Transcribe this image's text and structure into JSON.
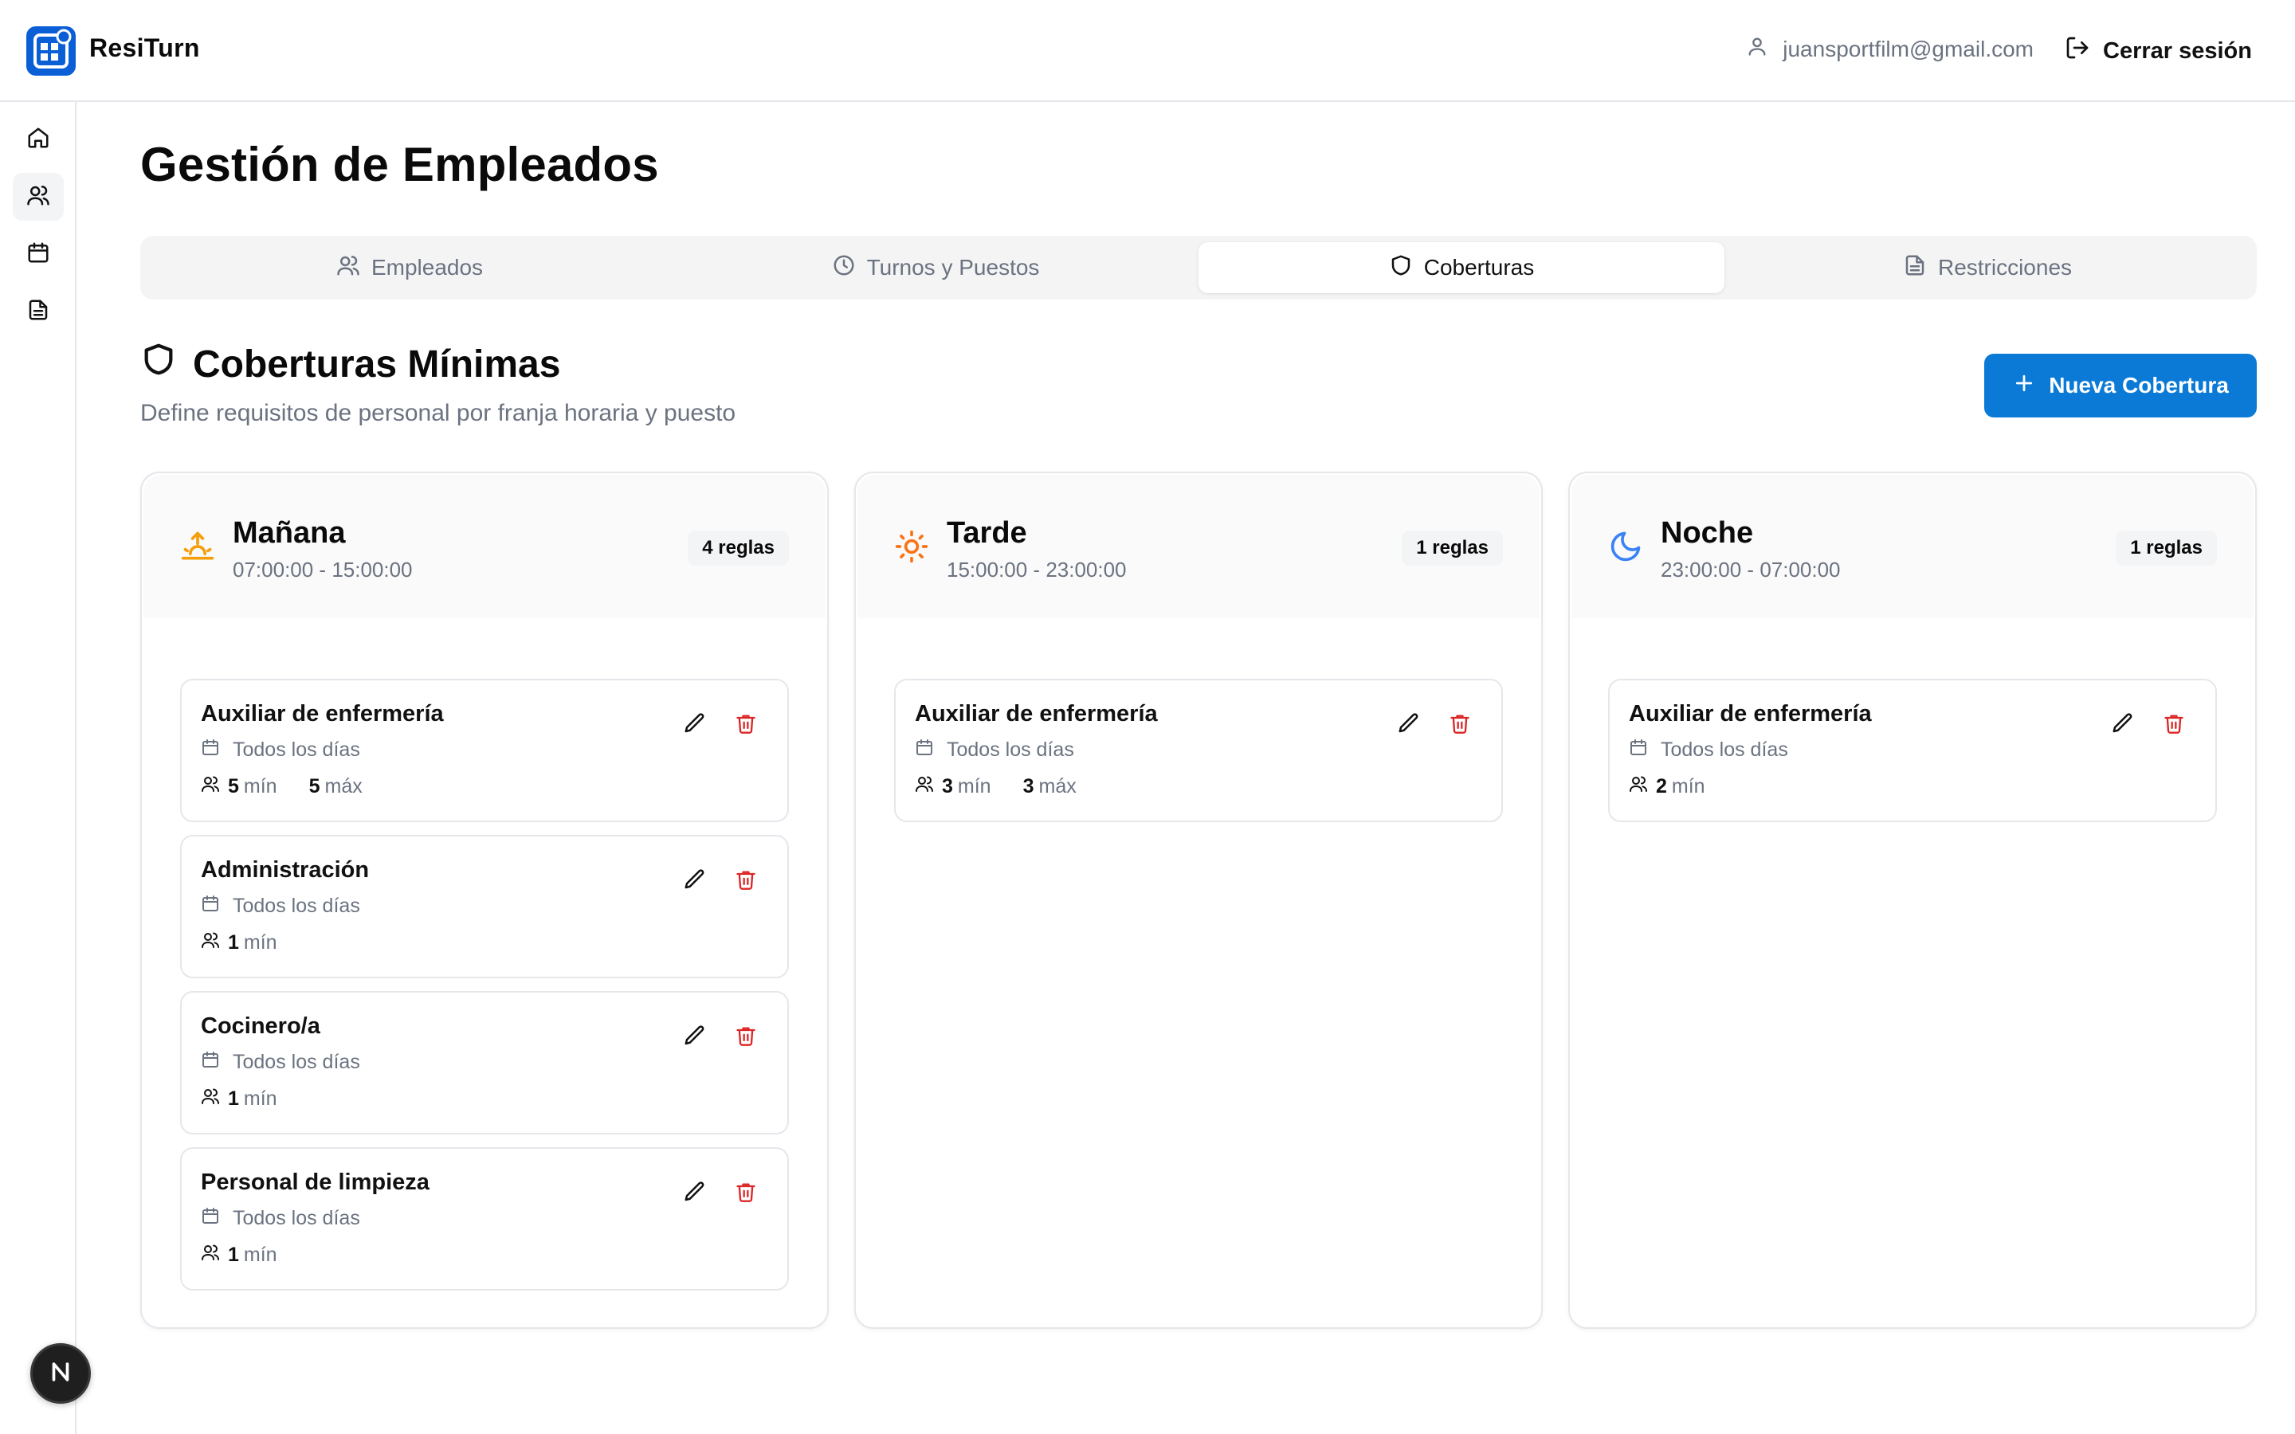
{
  "app": {
    "title": "ResiTurn"
  },
  "header": {
    "user_email": "juansportfilm@gmail.com",
    "logout_label": "Cerrar sesión"
  },
  "page": {
    "title": "Gestión de Empleados"
  },
  "tabs": [
    {
      "label": "Empleados",
      "icon": "users-icon"
    },
    {
      "label": "Turnos y Puestos",
      "icon": "clock-icon"
    },
    {
      "label": "Coberturas",
      "icon": "shield-icon",
      "active": true
    },
    {
      "label": "Restricciones",
      "icon": "file-text-icon"
    }
  ],
  "section": {
    "title": "Coberturas Mínimas",
    "description": "Define requisitos de personal por franja horaria y puesto",
    "new_button": "Nueva Cobertura"
  },
  "shifts": [
    {
      "name": "Mañana",
      "time": "07:00:00 - 15:00:00",
      "badge": "4 reglas",
      "icon": "sunrise-icon",
      "rules": [
        {
          "name": "Auxiliar de enfermería",
          "days": "Todos los días",
          "min": "5",
          "min_label": "mín",
          "max": "5",
          "max_label": "máx"
        },
        {
          "name": "Administración",
          "days": "Todos los días",
          "min": "1",
          "min_label": "mín"
        },
        {
          "name": "Cocinero/a",
          "days": "Todos los días",
          "min": "1",
          "min_label": "mín"
        },
        {
          "name": "Personal de limpieza",
          "days": "Todos los días",
          "min": "1",
          "min_label": "mín"
        }
      ]
    },
    {
      "name": "Tarde",
      "time": "15:00:00 - 23:00:00",
      "badge": "1 reglas",
      "icon": "sun-icon",
      "rules": [
        {
          "name": "Auxiliar de enfermería",
          "days": "Todos los días",
          "min": "3",
          "min_label": "mín",
          "max": "3",
          "max_label": "máx"
        }
      ]
    },
    {
      "name": "Noche",
      "time": "23:00:00 - 07:00:00",
      "badge": "1 reglas",
      "icon": "moon-icon",
      "rules": [
        {
          "name": "Auxiliar de enfermería",
          "days": "Todos los días",
          "min": "2",
          "min_label": "mín"
        }
      ]
    }
  ],
  "colors": {
    "primary": "#0b7ad6",
    "sunrise": "#f59e0b",
    "sun": "#f97316",
    "moon": "#3b82f6",
    "delete": "#dc2626"
  }
}
